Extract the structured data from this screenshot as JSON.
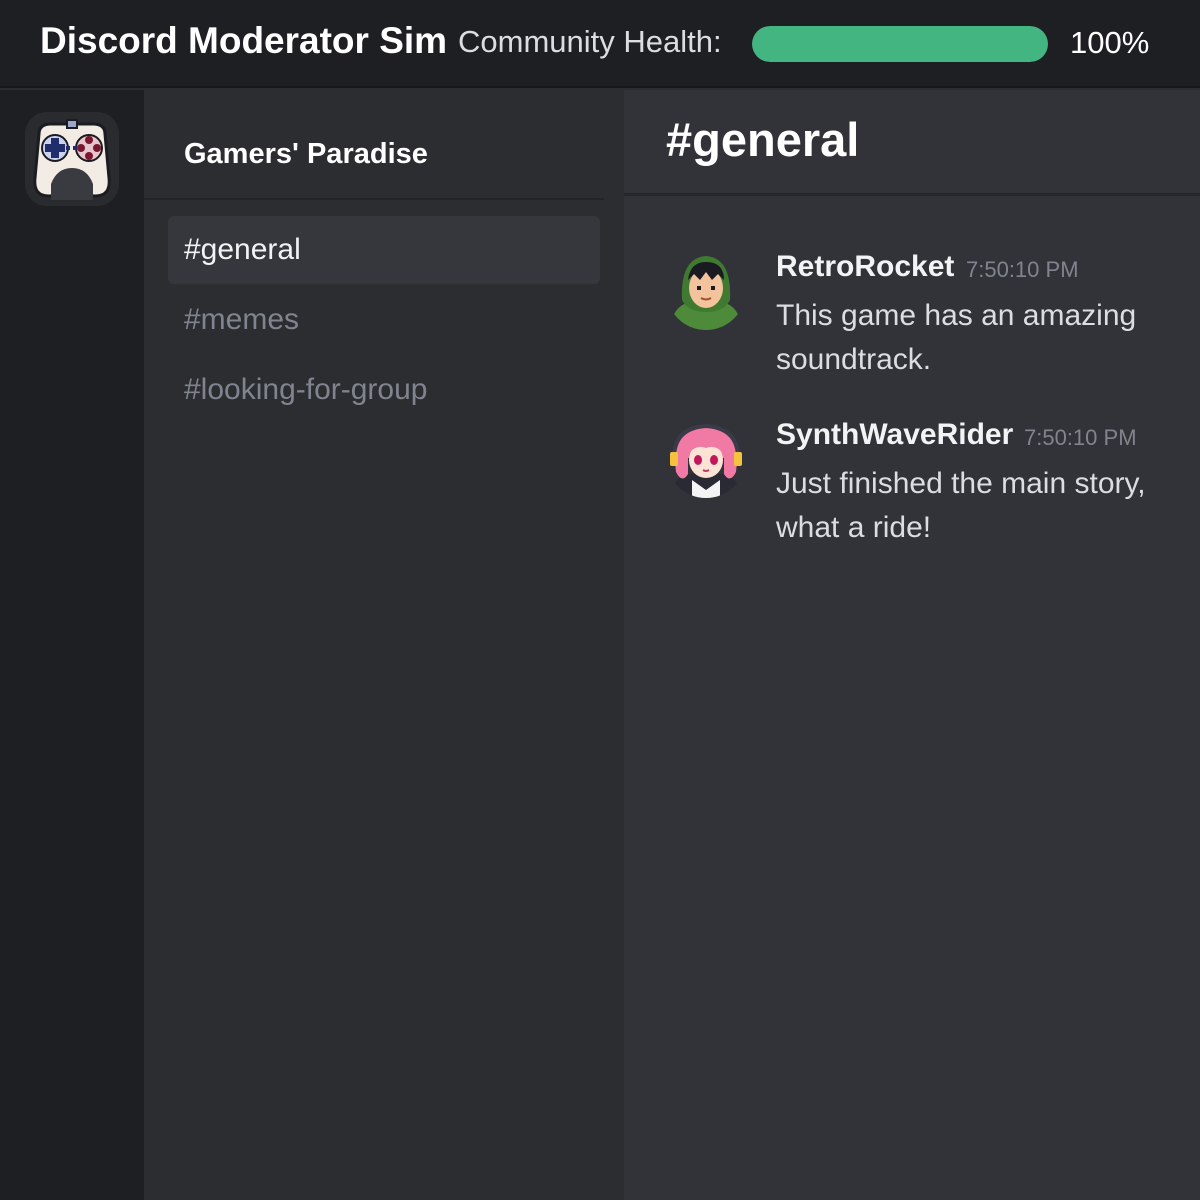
{
  "app": {
    "title": "Discord Moderator Sim"
  },
  "health": {
    "label": "Community Health:",
    "value_text": "100%",
    "fraction": 1.0,
    "color": "#43b581"
  },
  "server": {
    "name": "Gamers' Paradise",
    "icon": "gamepad-icon"
  },
  "channels": [
    {
      "label": "#general",
      "active": true
    },
    {
      "label": "#memes",
      "active": false
    },
    {
      "label": "#looking-for-group",
      "active": false
    }
  ],
  "chat": {
    "title": "#general",
    "messages": [
      {
        "author": "RetroRocket",
        "time": "7:50:10 PM",
        "text": "This game has an amazing soundtrack.",
        "avatar": "hooded-boy-avatar"
      },
      {
        "author": "SynthWaveRider",
        "time": "7:50:10 PM",
        "text": "Just finished the main story, what a ride!",
        "avatar": "pink-hair-girl-avatar"
      }
    ]
  }
}
